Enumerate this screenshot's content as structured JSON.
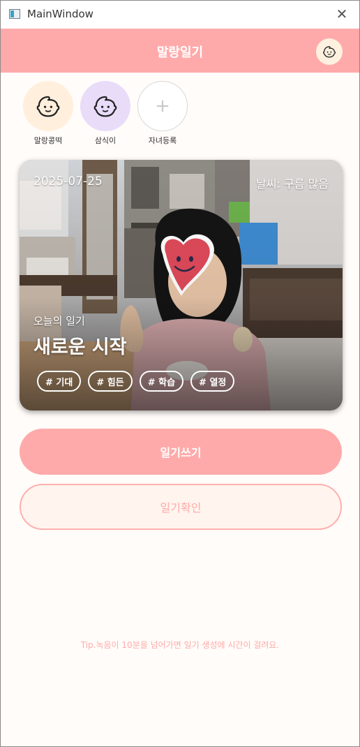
{
  "window": {
    "title": "MainWindow",
    "close_glyph": "✕"
  },
  "header": {
    "title": "말랑일기",
    "avatar_icon": "baby-face-icon"
  },
  "children": [
    {
      "label": "말랑콩떡",
      "icon": "baby-face-icon",
      "color": "#ffefdc"
    },
    {
      "label": "삼식이",
      "icon": "baby-face-icon",
      "color": "#e8dcf9"
    },
    {
      "label": "자녀등록",
      "icon": "plus-icon",
      "glyph": "+"
    }
  ],
  "card": {
    "date": "2025-07-25",
    "weather": "날씨: 구름 많음",
    "subtitle": "오늘의 일기",
    "title": "새로운 시작",
    "tags": [
      "# 기대",
      "# 힘든",
      "# 학습",
      "# 열정"
    ]
  },
  "buttons": {
    "write": "일기쓰기",
    "check": "일기확인"
  },
  "tip": "Tip.녹음이 10분을 넘어가면 일기 생성에 시간이 걸려요.",
  "colors": {
    "accent": "#ffaaaa",
    "background": "#fffcf9"
  }
}
